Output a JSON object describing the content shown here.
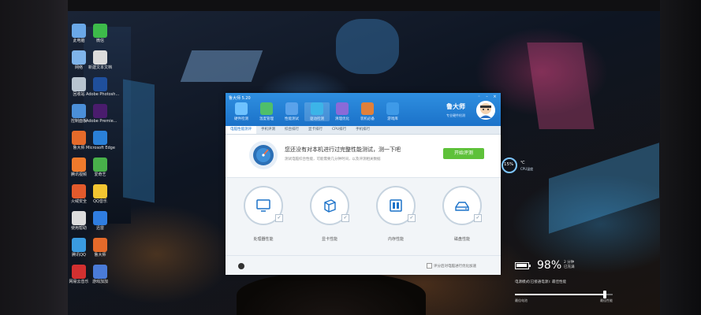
{
  "desktop": {
    "icons": [
      {
        "label": "此电脑",
        "color": "#6aa8e8"
      },
      {
        "label": "微信",
        "color": "#3dbb4a"
      },
      {
        "label": "网络",
        "color": "#7fb4ea"
      },
      {
        "label": "新建文本文档",
        "color": "#dcdcdc"
      },
      {
        "label": "回收站",
        "color": "#b8c4cf"
      },
      {
        "label": "Adobe Photosh...",
        "color": "#1f4f9c"
      },
      {
        "label": "控制面板",
        "color": "#4b8fd8"
      },
      {
        "label": "Adobe Premie...",
        "color": "#4a1c6d"
      },
      {
        "label": "鲁大师",
        "color": "#e46a2a"
      },
      {
        "label": "Microsoft Edge",
        "color": "#2a80d8"
      },
      {
        "label": "腾讯视频",
        "color": "#ee7a2c"
      },
      {
        "label": "爱奇艺",
        "color": "#48b04a"
      },
      {
        "label": "火绒安全",
        "color": "#e25a2c"
      },
      {
        "label": "QQ音乐",
        "color": "#f2c531"
      },
      {
        "label": "使用帮助",
        "color": "#dcdcdc"
      },
      {
        "label": "迅雷",
        "color": "#2f7de0"
      },
      {
        "label": "腾讯QQ",
        "color": "#3a9be0"
      },
      {
        "label": "鲁大师",
        "color": "#e46a2a"
      },
      {
        "label": "网易云音乐",
        "color": "#d23030"
      },
      {
        "label": "游戏加加",
        "color": "#4a7bd8"
      }
    ]
  },
  "app": {
    "title": "鲁大师 5.20",
    "controls": [
      "◦",
      "–",
      "×"
    ],
    "nav": [
      {
        "label": "硬件检测",
        "color": "#6ec2ff"
      },
      {
        "label": "温度管理",
        "color": "#4fbf6a"
      },
      {
        "label": "性能测试",
        "color": "#5aa2ea"
      },
      {
        "label": "驱动检测",
        "color": "#3cb4e8"
      },
      {
        "label": "清理优化",
        "color": "#8a6ad8"
      },
      {
        "label": "装机必备",
        "color": "#e0803a"
      },
      {
        "label": "游戏库",
        "color": "#3e9ae8"
      }
    ],
    "brand": {
      "name": "鲁大师",
      "sub": "专业硬件检测"
    },
    "subtabs": [
      "电脑性能测评",
      "手机评测",
      "综合排行",
      "显卡排行",
      "CPU排行",
      "手机排行"
    ],
    "hero": {
      "title": "您还没有对本机进行过完整性能测试，测一下吧",
      "desc": "测试电脑综合性能，可能需要几分钟时间，以及评测相关数据",
      "start_label": "开始评测"
    },
    "items": [
      {
        "label": "处理器性能",
        "glyph": "monitor-icon"
      },
      {
        "label": "显卡性能",
        "glyph": "cube-icon"
      },
      {
        "label": "内存性能",
        "glyph": "memory-icon"
      },
      {
        "label": "磁盘性能",
        "glyph": "disk-icon"
      }
    ],
    "footer": {
      "option": "评分后对电脑进行优化加速"
    }
  },
  "cpu_widget": {
    "percent": "15%",
    "temp": "℃",
    "label": "CPU温度"
  },
  "battery": {
    "percent": "98%",
    "percent_value": 98,
    "remaining": "2 分钟\n已充满",
    "status": "电源模式(已接通电源): 最佳性能",
    "slider_value": 0.92,
    "left_label": "最佳电池",
    "right_label": "最佳性能"
  }
}
